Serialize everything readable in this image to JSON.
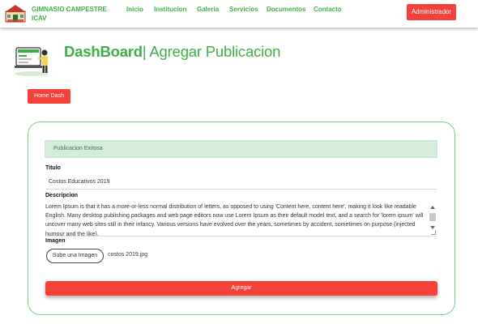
{
  "navbar": {
    "brand": "GIMNASIO CAMPESTRE ICAV",
    "links": [
      "Inicio",
      "Institucion",
      "Galeria",
      "Servicios",
      "Documentos",
      "Contacto"
    ],
    "admin_button": "Administrador"
  },
  "header": {
    "title_bold": "DashBoard",
    "title_separator": "|",
    "title_rest": " Agregar Publicacion"
  },
  "home_button": "Home Dash",
  "alert": "Publicacion Exitosa",
  "form": {
    "titulo_label": "Titulo",
    "titulo_value": "Costos Educativos 2019",
    "descripcion_label": "Descripcion",
    "descripcion_value": "Lorem Ipsum is that it has a more-or-less normal distribution of letters, as opposed to using 'Content here, content here', making it look like readable English. Many desktop publishing packages and web page editors now use Lorem Ipsum as their default model text, and a search for 'lorem ipsum' will uncover many web sites still in their infancy. Various versions have evolved over the years, sometimes by accident, sometimes on purpose (injected humour and the like).",
    "imagen_label": "Imagen",
    "upload_button": "Sube una Imagen",
    "file_name": "costos 2019.jpg",
    "submit_button": "Agregar"
  },
  "colors": {
    "brand_green": "#3fae4a",
    "accent_red": "#f4413a",
    "alert_bg": "#d4ecda"
  },
  "icons": [
    "school-logo-icon",
    "dashboard-illustration-icon"
  ]
}
